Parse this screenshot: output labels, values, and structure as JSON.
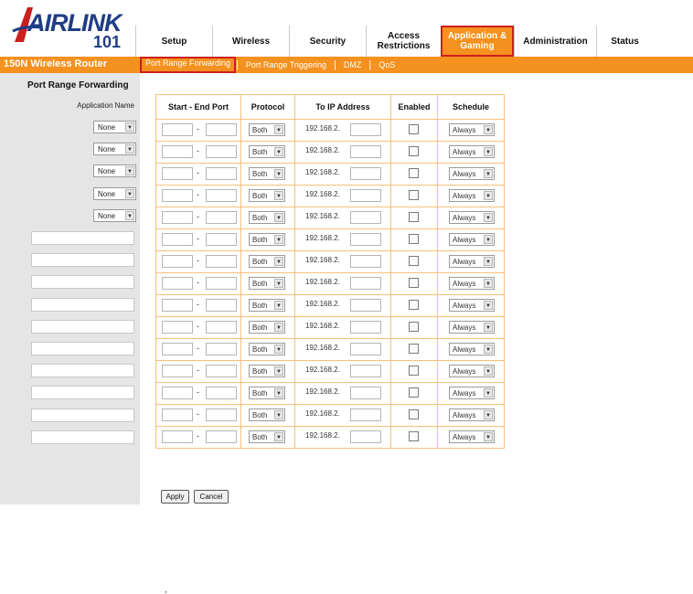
{
  "logo": {
    "brand": "AIRLINK",
    "suffix": "101"
  },
  "nav": [
    {
      "label": "Setup",
      "active": false,
      "width": 84
    },
    {
      "label": "Wireless",
      "active": false,
      "width": 84
    },
    {
      "label": "Security",
      "active": false,
      "width": 84
    },
    {
      "label": "Access Restrictions",
      "active": false,
      "width": 82
    },
    {
      "label": "Application & Gaming",
      "active": true,
      "width": 80
    },
    {
      "label": "Administration",
      "active": false,
      "width": 90
    },
    {
      "label": "Status",
      "active": false,
      "width": 62
    }
  ],
  "product_name": "150N Wireless Router",
  "subnav": [
    {
      "label": "Port Range Forwarding",
      "active": true
    },
    {
      "label": "Port Range Triggering",
      "active": false
    },
    {
      "label": "DMZ",
      "active": false
    },
    {
      "label": "QoS",
      "active": false
    }
  ],
  "section_title": "Port Range Forwarding",
  "sidebar": {
    "app_name_label": "Application Name",
    "select_rows": 5,
    "input_rows": 10,
    "select_value": "None"
  },
  "table": {
    "headers": [
      "Start - End Port",
      "Protocol",
      "To IP Address",
      "Enabled",
      "Schedule"
    ],
    "row_count": 15,
    "protocol_value": "Both",
    "ip_prefix": "192.168.2.",
    "schedule_value": "Always"
  },
  "buttons": {
    "apply": "Apply",
    "cancel": "Cancel"
  }
}
